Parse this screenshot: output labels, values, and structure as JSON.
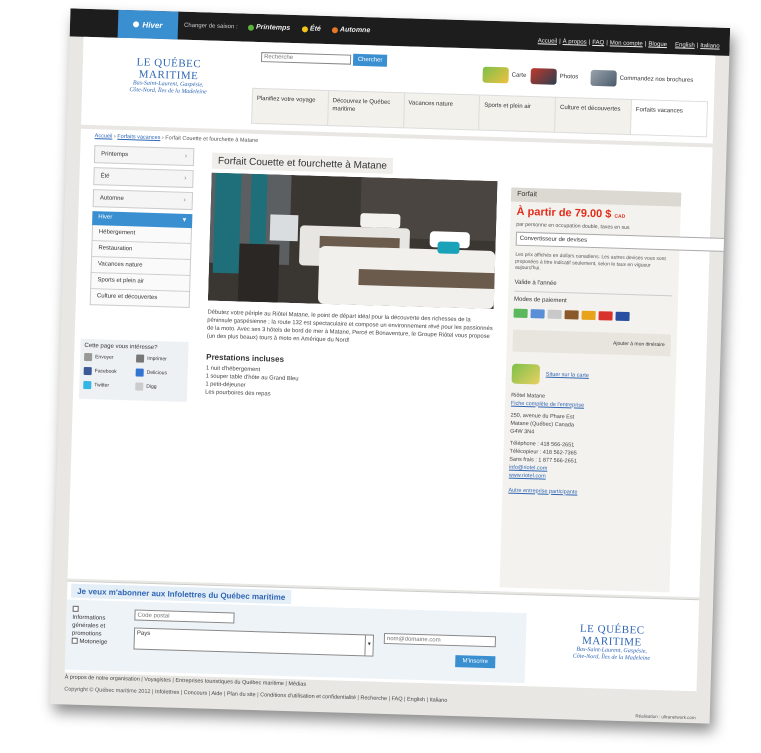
{
  "topbar": {
    "active_season": "Hiver",
    "change_label": "Changer de saison :",
    "seasons": [
      "Printemps",
      "Été",
      "Automne"
    ],
    "season_colors": [
      "#5bb33a",
      "#f3c41a",
      "#e8772a"
    ],
    "utility_links": [
      "Accueil",
      "À propos",
      "FAQ",
      "Mon compte",
      "Blogue",
      "English",
      "Italiano"
    ]
  },
  "header": {
    "logo_name": "LE QUÉBEC MARITIME",
    "logo_sub_1": "Bas-Saint-Laurent, Gaspésie,",
    "logo_sub_2": "Côte-Nord, Îles de la Madeleine",
    "search_placeholder": "Recherche",
    "search_button": "Chercher",
    "quick_links": [
      "Carte",
      "Photos",
      "Commandez nos brochures"
    ],
    "nav": [
      "Planifiez votre voyage",
      "Découvrez le Québec maritime",
      "Vacances nature",
      "Sports et plein air",
      "Culture et découvertes",
      "Forfaits vacances"
    ]
  },
  "breadcrumb": {
    "home": "Accueil",
    "section": "Forfaits vacances",
    "current": "Forfait Couette et fourchette à Matane"
  },
  "sidebar": {
    "seasons": [
      "Printemps",
      "Été",
      "Automne"
    ],
    "active": "Hiver",
    "subitems": [
      "Hébergement",
      "Restauration",
      "Vacances nature",
      "Sports et plein air",
      "Culture et découvertes"
    ]
  },
  "share": {
    "title": "Cette page vous intéresse?",
    "items": [
      "Envoyer",
      "Imprimer",
      "Facebook",
      "Delicious",
      "Twitter",
      "Digg"
    ]
  },
  "main": {
    "title": "Forfait Couette et fourchette à Matane",
    "description": "Débutez votre périple au Riôtel Matane, le point de départ idéal pour la découverte des richesses de la péninsule gaspésienne ; la route 132 est spectaculaire et compose un environnement rêvé pour les passionnés de la moto. Avec ses 3 hôtels de bord de mer à Matane, Percé et Bonaventure, le Groupe Riôtel vous propose (un des plus beaux) tours à moto en Amérique du Nord!",
    "prestations_title": "Prestations incluses",
    "prestations": [
      "1 nuit d'hébergement",
      "1 souper table d'hôte au Grand Bleu",
      "1 petit-déjeuner",
      "Les pourboires des repas"
    ]
  },
  "forfait": {
    "head": "Forfait",
    "price": "À partir de 79.00 $",
    "currency": "CAD",
    "price_sub": "par personne en occupation double, taxes en sus",
    "converter": "Convertisseur de devises",
    "note": "Les prix affichés en dollars canadiens. Les autres devises vous sont proposées à titre indicatif seulement, selon le taux en vigueur aujourd'hui.",
    "validity": "Valide à l'année",
    "payment_title": "Modes de paiement",
    "card_colors": [
      "#5cb85c",
      "#5a8fd8",
      "#c9c9c9",
      "#8b5a2b",
      "#e8a31a",
      "#d9312b",
      "#2a4ea0"
    ],
    "itinerary": "Ajouter à mon itinéraire",
    "map_link": "Situer sur la carte",
    "contact": {
      "name": "Riôtel Matane",
      "profile_link": "Fiche complète de l'entreprise",
      "addr1": "250, avenue du Phare Est",
      "addr2": "Matane (Québec) Canada",
      "addr3": "G4W 3N4",
      "phone": "Téléphone : 418 566-2651",
      "fax": "Télécopieur : 418 562-7365",
      "tollfree": "Sans frais : 1 877 566-2651",
      "email": "info@riotel.com",
      "web": "www.riotel.com"
    },
    "other": "Autre entreprise participante"
  },
  "subscribe": {
    "title": "Je veux m'abonner aux Infolettres du Québec maritime",
    "opt1": "Informations générales et promotions",
    "opt2": "Motoneige",
    "postal_placeholder": "Code postal",
    "country": "Pays",
    "email_placeholder": "nom@domaine.com",
    "button": "M'inscrire"
  },
  "footer": {
    "row1": [
      "À propos de notre organisation",
      "Voyagistes",
      "Entreprises touristiques du Québec maritime",
      "Médias"
    ],
    "row2": [
      "Copyright © Québec maritime 2012",
      "Infolettres",
      "Concours",
      "Aide",
      "Plan du site",
      "Conditions d'utilisation et confidentialité",
      "Recherche",
      "FAQ",
      "English",
      "Italiano"
    ],
    "credit": "Réalisation : ultranetwork.com"
  }
}
